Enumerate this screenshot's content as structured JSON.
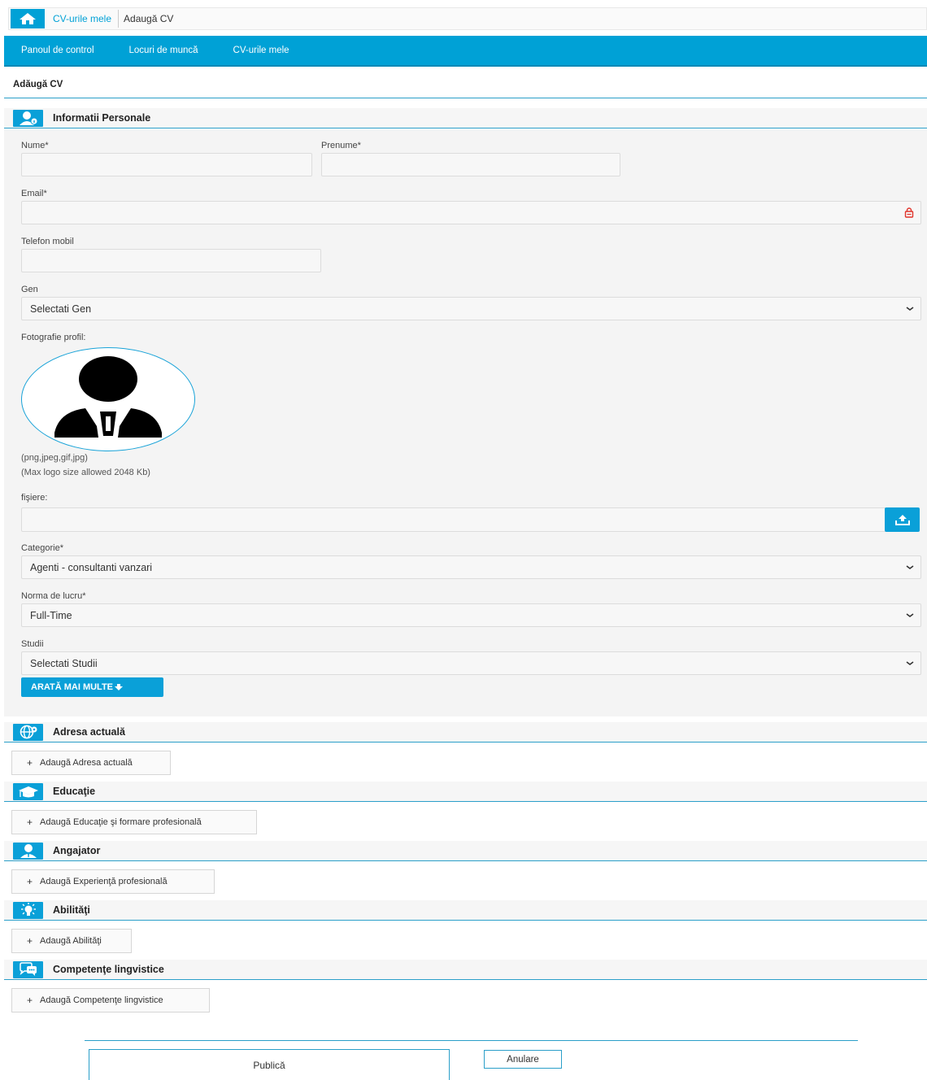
{
  "breadcrumb": {
    "link": "CV-urile mele",
    "current": "Adaugă CV"
  },
  "nav": {
    "items": [
      "Panoul de control",
      "Locuri de muncă",
      "CV-urile mele"
    ]
  },
  "page_title": "Adăugă CV",
  "sections": {
    "personal": "Informatii Personale",
    "address": "Adresa actuală",
    "education": "Educaţie",
    "employer": "Angajator",
    "skills": "Abilităţi",
    "languages": "Competenţe lingvistice"
  },
  "form": {
    "nume_label": "Nume*",
    "prenume_label": "Prenume*",
    "email_label": "Email*",
    "telefon_label": "Telefon mobil",
    "gen_label": "Gen",
    "gen_value": "Selectati Gen",
    "foto_label": "Fotografie profil:",
    "foto_formats": "(png,jpeg,gif,jpg)",
    "foto_max": "(Max logo size allowed 2048 Kb)",
    "fisiere_label": "fişiere:",
    "categorie_label": "Categorie*",
    "categorie_value": "Agenti - consultanti vanzari",
    "norma_label": "Norma de lucru*",
    "norma_value": "Full-Time",
    "studii_label": "Studii",
    "studii_value": "Selectati Studii",
    "more_button": "ARATĂ MAI MULTE"
  },
  "add_buttons": {
    "address": "Adaugă Adresa actuală",
    "education": "Adaugă Educaţie şi formare profesională",
    "employer": "Adaugă Experienţă profesională",
    "skills": "Adaugă Abilităţi",
    "languages": "Adaugă Competenţe lingvistice"
  },
  "actions": {
    "publish": "Publică",
    "cancel": "Anulare"
  },
  "colors": {
    "accent": "#00a1d6",
    "rule": "#2b9fc9",
    "panel_bg": "#f4f4f4"
  }
}
